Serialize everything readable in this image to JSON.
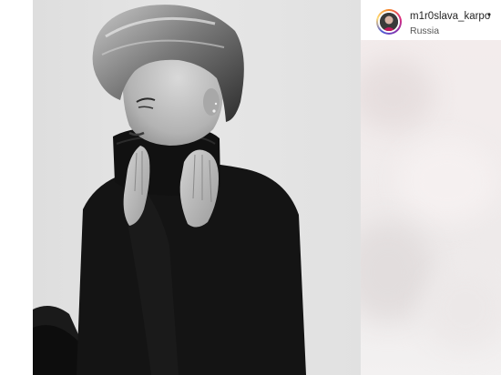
{
  "post": {
    "username": "m1r0slava_karpo",
    "separator": "•",
    "location": "Russia"
  },
  "icons": {
    "avatar": "profile-avatar-icon"
  },
  "colors": {
    "photo_background": "#e3e3e3",
    "comments_background": "#f1ecec",
    "username_text": "#262626",
    "location_text": "#555555"
  }
}
